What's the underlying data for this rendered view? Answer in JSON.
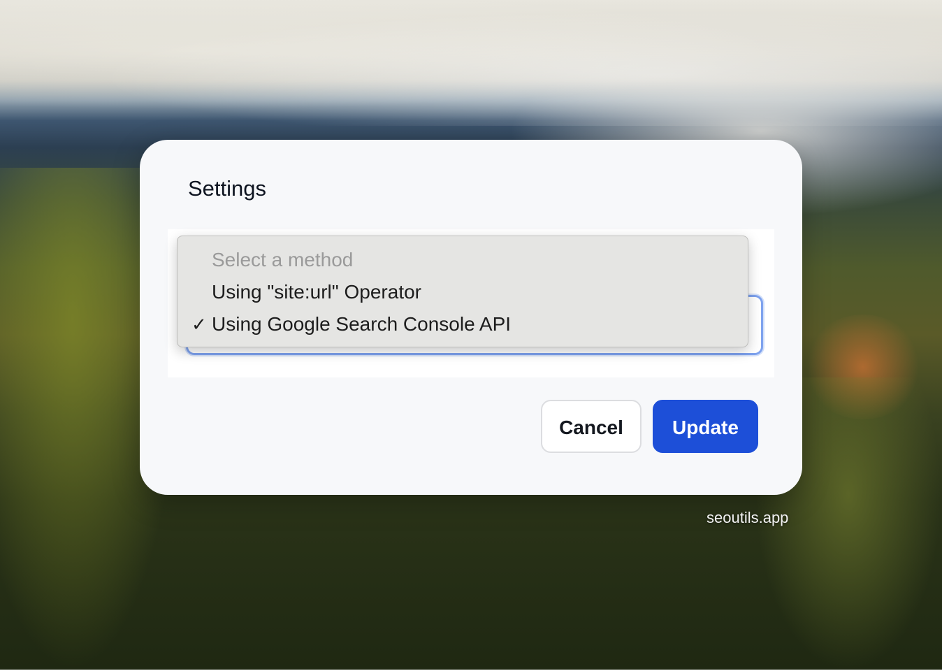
{
  "dialog": {
    "title": "Settings",
    "method_select": {
      "options": [
        {
          "label": "Select a method",
          "placeholder": true,
          "selected": false
        },
        {
          "label": "Using \"site:url\" Operator",
          "placeholder": false,
          "selected": false
        },
        {
          "label": "Using Google Search Console API",
          "placeholder": false,
          "selected": true
        }
      ],
      "check_glyph": "✓",
      "focus_color": "#7ea2ee"
    },
    "buttons": {
      "cancel_label": "Cancel",
      "update_label": "Update"
    },
    "colors": {
      "primary": "#1d4fd8",
      "dialog_bg": "#f7f8fa"
    }
  },
  "watermark": "seoutils.app"
}
